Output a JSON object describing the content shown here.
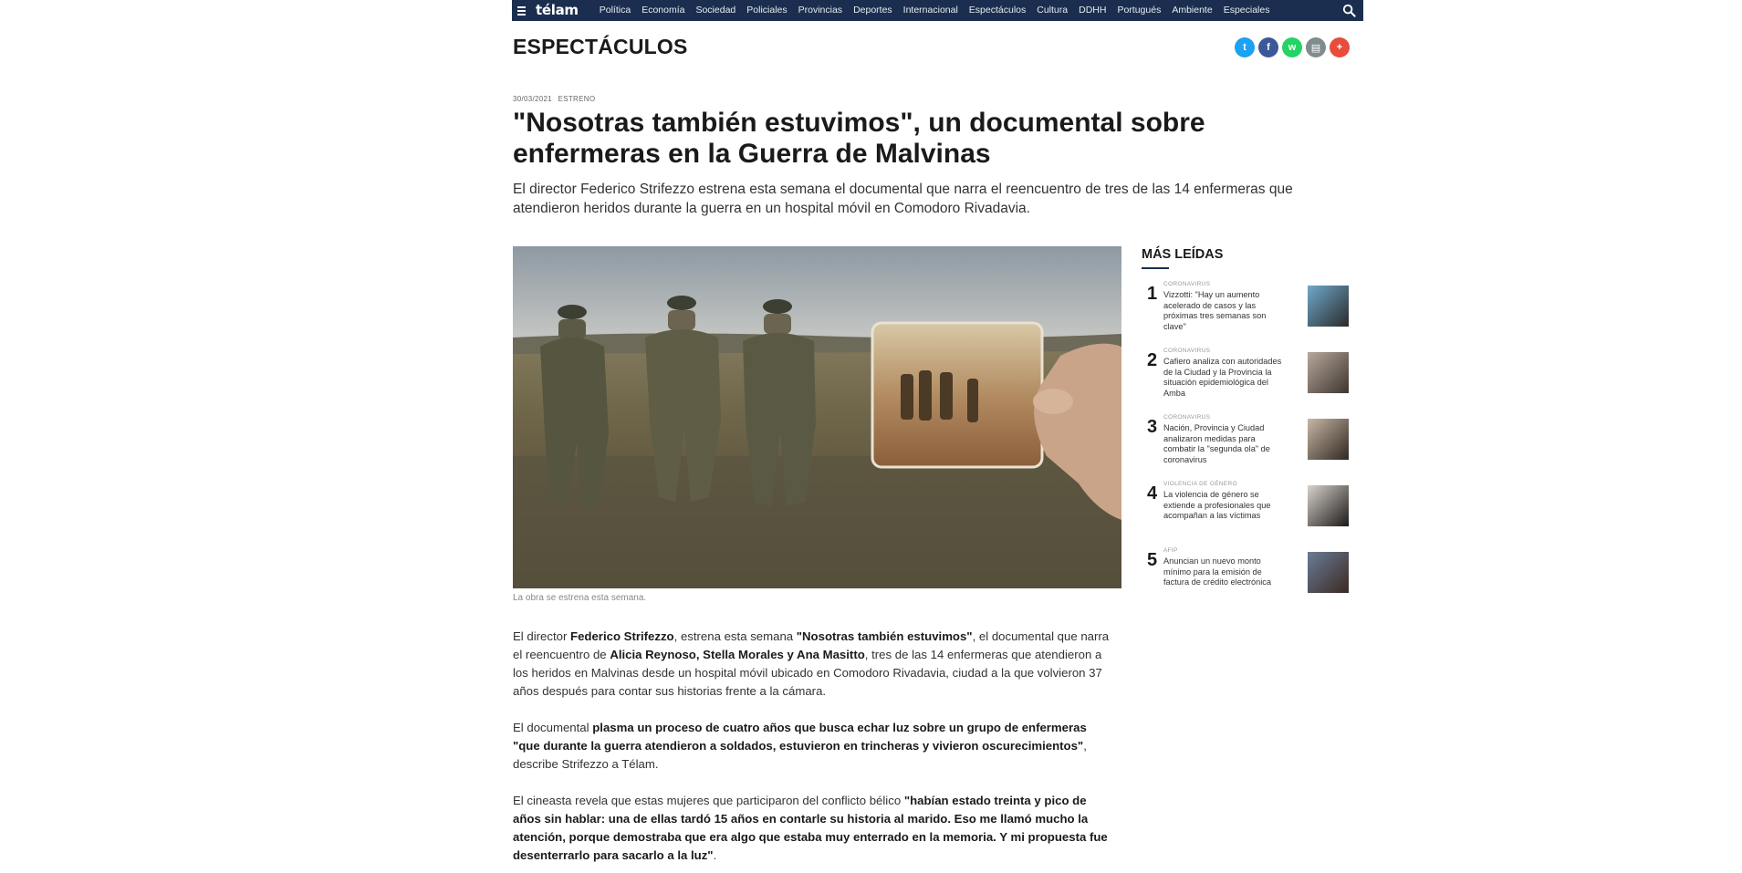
{
  "nav": {
    "logo": "télam",
    "items": [
      "Política",
      "Economía",
      "Sociedad",
      "Policiales",
      "Provincias",
      "Deportes",
      "Internacional",
      "Espectáculos",
      "Cultura",
      "DDHH",
      "Portugués",
      "Ambiente",
      "Especiales"
    ]
  },
  "section": {
    "title": "ESPECTÁCULOS"
  },
  "share": [
    {
      "icon": "twitter-icon",
      "glyph": "t",
      "color": "#1da1f2"
    },
    {
      "icon": "facebook-icon",
      "glyph": "f",
      "color": "#3b5998"
    },
    {
      "icon": "whatsapp-icon",
      "glyph": "w",
      "color": "#25d366"
    },
    {
      "icon": "print-icon",
      "glyph": "▤",
      "color": "#7f8c8d"
    },
    {
      "icon": "plus-icon",
      "glyph": "+",
      "color": "#e74c3c"
    }
  ],
  "article": {
    "date": "30/03/2021",
    "tag": "ESTRENO",
    "headline": "\"Nosotras también estuvimos\", un documental sobre enfermeras en la Guerra de Malvinas",
    "subhead": "El director Federico Strifezzo estrena esta semana el documental que narra el reencuentro de tres de las 14 enfermeras que atendieron heridos durante la guerra en un hospital móvil en Comodoro Rivadavia.",
    "caption": "La obra se estrena esta semana.",
    "p1": [
      {
        "t": "El director ",
        "b": false
      },
      {
        "t": "Federico Strifezzo",
        "b": true
      },
      {
        "t": ", estrena esta semana ",
        "b": false
      },
      {
        "t": "\"Nosotras también estuvimos\"",
        "b": true
      },
      {
        "t": ", el documental que narra el reencuentro de ",
        "b": false
      },
      {
        "t": "Alicia Reynoso, Stella Morales y Ana Masitto",
        "b": true
      },
      {
        "t": ", tres de las 14 enfermeras que atendieron a los heridos en Malvinas desde un hospital móvil ubicado en Comodoro Rivadavia, ciudad a la que volvieron 37 años después para contar sus historias frente a la cámara.",
        "b": false
      }
    ],
    "p2": [
      {
        "t": "El documental ",
        "b": false
      },
      {
        "t": "plasma un proceso de cuatro años que busca echar luz sobre un grupo de enfermeras \"que durante la guerra atendieron a soldados, estuvieron en trincheras y vivieron oscurecimientos\"",
        "b": true
      },
      {
        "t": ", describe Strifezzo a Télam.",
        "b": false
      }
    ],
    "p3": [
      {
        "t": "El cineasta revela que estas mujeres que participaron del conflicto bélico ",
        "b": false
      },
      {
        "t": "\"habían estado treinta y pico de años sin hablar: una de ellas tardó 15 años en contarle su historia al marido. Eso me llamó mucho la atención, porque demostraba que era algo que estaba muy enterrado en la memoria. Y mi propuesta fue desenterrarlo para sacarlo a la luz\"",
        "b": true
      },
      {
        "t": ".",
        "b": false
      }
    ]
  },
  "sidebar": {
    "title": "MÁS LEÍDAS",
    "items": [
      {
        "num": "1",
        "section": "CORONAVIRUS",
        "text": "Vizzotti: \"Hay un aumento acelerado de casos y las próximas tres semanas son clave\""
      },
      {
        "num": "2",
        "section": "CORONAVIRUS",
        "text": "Cafiero analiza con autoridades de la Ciudad y la Provincia la situación epidemiológica del Amba"
      },
      {
        "num": "3",
        "section": "CORONAVIRUS",
        "text": "Nación, Provincia y Ciudad analizaron medidas para combatir la \"segunda ola\" de coronavirus"
      },
      {
        "num": "4",
        "section": "VIOLENCIA DE GÉNERO",
        "text": "La violencia de género se extiende a profesionales que acompañan a las víctimas"
      },
      {
        "num": "5",
        "section": "AFIP",
        "text": "Anuncian un nuevo monto mínimo para la emisión de factura de crédito electrónica"
      }
    ]
  }
}
